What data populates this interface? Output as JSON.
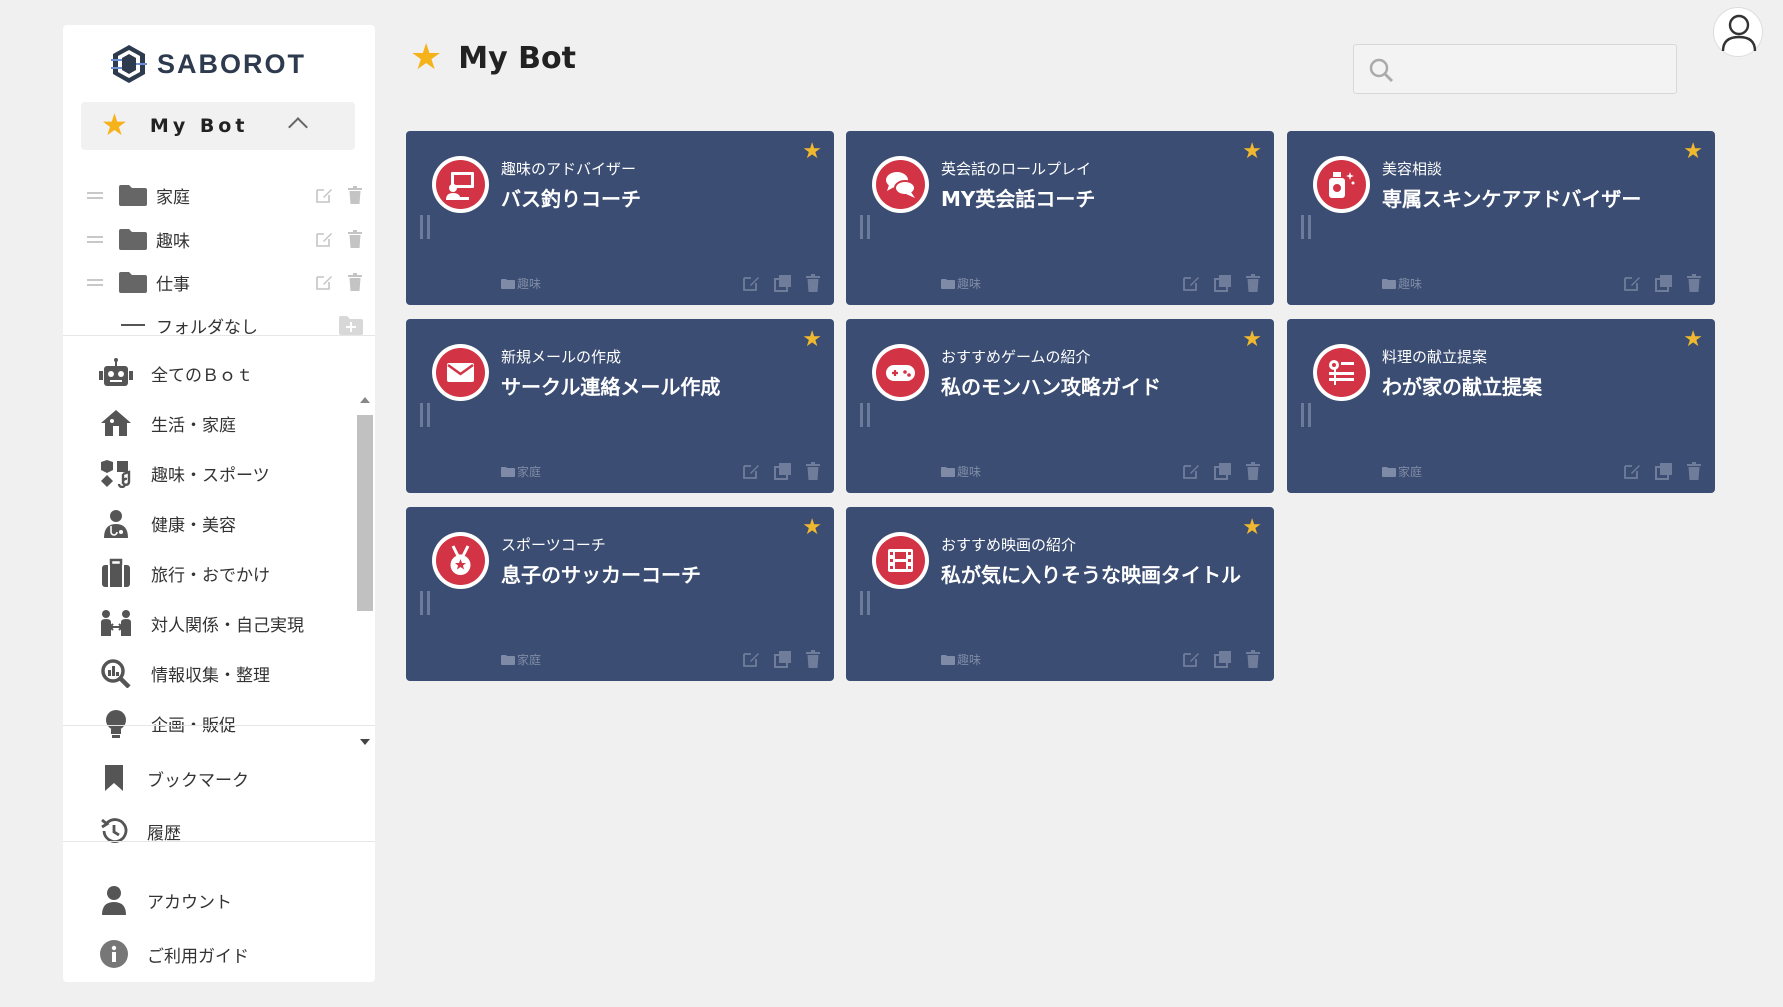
{
  "app": {
    "brand": "SABOROT"
  },
  "sidebar": {
    "mybot_label": "My Bot",
    "folders": [
      {
        "name": "家庭"
      },
      {
        "name": "趣味"
      },
      {
        "name": "仕事"
      }
    ],
    "no_folder_label": "フォルダなし",
    "categories": [
      {
        "name": "全てのＢｏｔ",
        "icon": "robot-icon"
      },
      {
        "name": "生活・家庭",
        "icon": "house-icon"
      },
      {
        "name": "趣味・スポーツ",
        "icon": "hobby-icon"
      },
      {
        "name": "健康・美容",
        "icon": "doctor-icon"
      },
      {
        "name": "旅行・おでかけ",
        "icon": "suitcase-icon"
      },
      {
        "name": "対人関係・自己実現",
        "icon": "people-icon"
      },
      {
        "name": "情報収集・整理",
        "icon": "search-chart-icon"
      },
      {
        "name": "企画・販促",
        "icon": "lightbulb-icon"
      }
    ],
    "bookmark_label": "ブックマーク",
    "history_label": "履歴",
    "account_label": "アカウント",
    "guide_label": "ご利用ガイド"
  },
  "header": {
    "title": "My Bot",
    "search_placeholder": ""
  },
  "cards": [
    {
      "subtitle": "趣味のアドバイザー",
      "title": "バス釣りコーチ",
      "folder": "趣味",
      "icon": "teacher-board-icon"
    },
    {
      "subtitle": "英会話のロールプレイ",
      "title": "MY英会話コーチ",
      "folder": "趣味",
      "icon": "chat-bubbles-icon"
    },
    {
      "subtitle": "美容相談",
      "title": "専属スキンケアアドバイザー",
      "folder": "趣味",
      "icon": "skincare-bottle-icon"
    },
    {
      "subtitle": "新規メールの作成",
      "title": "サークル連絡メール作成",
      "folder": "家庭",
      "icon": "envelope-icon"
    },
    {
      "subtitle": "おすすめゲームの紹介",
      "title": "私のモンハン攻略ガイド",
      "folder": "趣味",
      "icon": "gamepad-icon"
    },
    {
      "subtitle": "料理の献立提案",
      "title": "わが家の献立提案",
      "folder": "家庭",
      "icon": "recipe-icon"
    },
    {
      "subtitle": "スポーツコーチ",
      "title": "息子のサッカーコーチ",
      "folder": "家庭",
      "icon": "medal-icon"
    },
    {
      "subtitle": "おすすめ映画の紹介",
      "title": "私が気に入りそうな映画タイトル",
      "folder": "趣味",
      "icon": "film-icon"
    }
  ],
  "colors": {
    "card_bg": "#3b4d72",
    "icon_red": "#d23445",
    "star_yellow": "#f5b21a",
    "page_bg": "#f0f0f0"
  }
}
